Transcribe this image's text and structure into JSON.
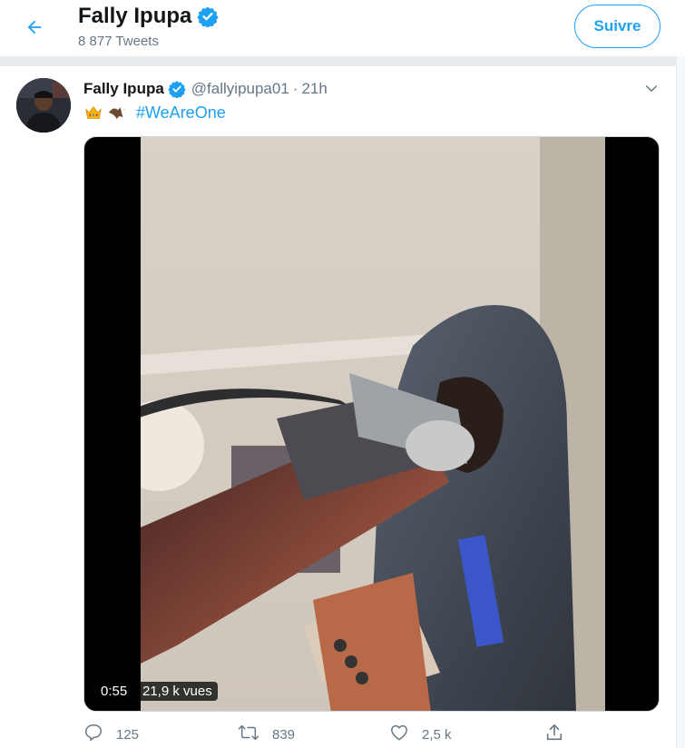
{
  "header": {
    "name": "Fally Ipupa",
    "tweet_count": "8 877 Tweets",
    "follow_label": "Suivre"
  },
  "tweet": {
    "name": "Fally Ipupa",
    "handle": "@fallyipupa01",
    "separator": "·",
    "time": "21h",
    "emojis": [
      "crown-emoji",
      "eagle-emoji"
    ],
    "hashtag": "#WeAreOne",
    "media": {
      "duration": "0:55",
      "views": "21,9 k vues"
    },
    "actions": {
      "replies": "125",
      "retweets": "839",
      "likes": "2,5 k"
    }
  },
  "colors": {
    "accent": "#1da1f2",
    "secondary_text": "#657786",
    "divider": "#e6ecf0"
  }
}
